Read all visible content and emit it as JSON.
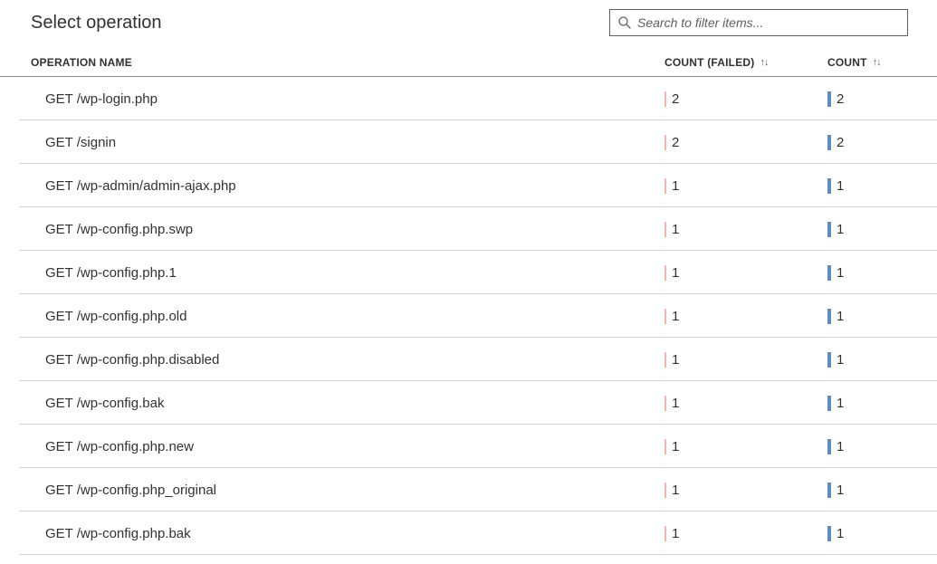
{
  "title": "Select operation",
  "search": {
    "placeholder": "Search to filter items..."
  },
  "columns": {
    "name": "OPERATION NAME",
    "failed": "COUNT (FAILED)",
    "count": "COUNT"
  },
  "rows": [
    {
      "name": "GET /wp-login.php",
      "failed": "2",
      "count": "2"
    },
    {
      "name": "GET /signin",
      "failed": "2",
      "count": "2"
    },
    {
      "name": "GET /wp-admin/admin-ajax.php",
      "failed": "1",
      "count": "1"
    },
    {
      "name": "GET /wp-config.php.swp",
      "failed": "1",
      "count": "1"
    },
    {
      "name": "GET /wp-config.php.1",
      "failed": "1",
      "count": "1"
    },
    {
      "name": "GET /wp-config.php.old",
      "failed": "1",
      "count": "1"
    },
    {
      "name": "GET /wp-config.php.disabled",
      "failed": "1",
      "count": "1"
    },
    {
      "name": "GET /wp-config.bak",
      "failed": "1",
      "count": "1"
    },
    {
      "name": "GET /wp-config.php.new",
      "failed": "1",
      "count": "1"
    },
    {
      "name": "GET /wp-config.php_original",
      "failed": "1",
      "count": "1"
    },
    {
      "name": "GET /wp-config.php.bak",
      "failed": "1",
      "count": "1"
    }
  ],
  "icons": {
    "search": "search-icon",
    "sort": "↑↓"
  }
}
